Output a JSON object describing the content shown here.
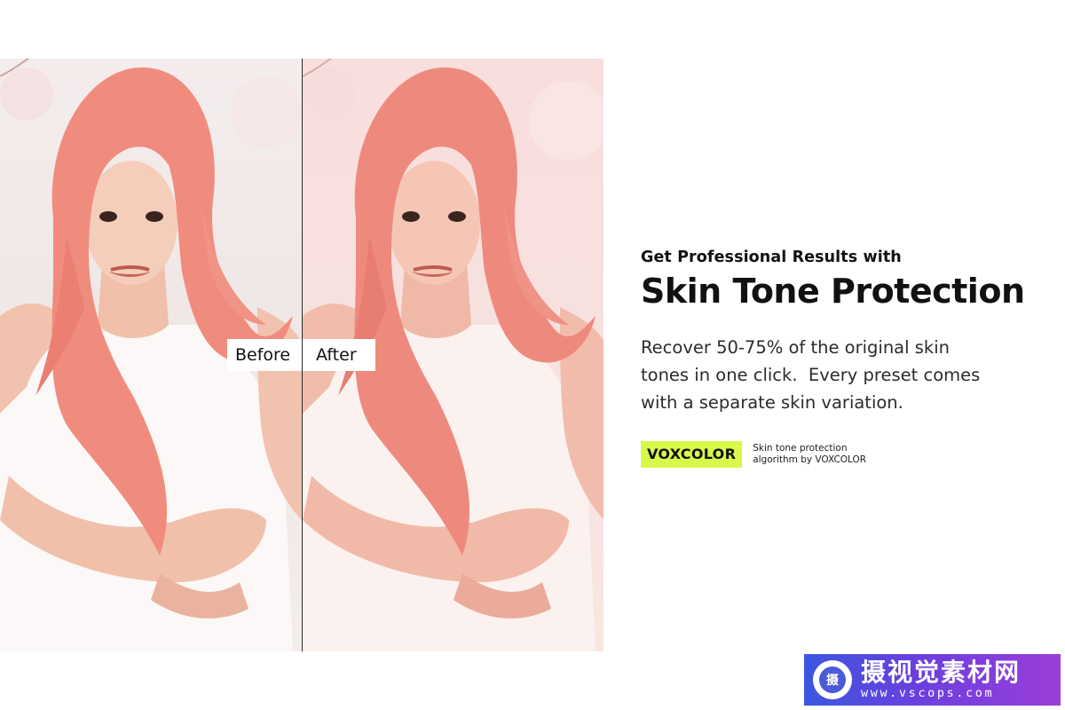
{
  "comparison": {
    "before_label": "Before",
    "after_label": "After",
    "colors": {
      "before_background": "#f1eae8",
      "after_background": "#f8dfdd",
      "hair": "#f08c7e",
      "skin_before": "#f3c8b4",
      "skin_after": "#f4c0b2",
      "dress": "#fbf8f7",
      "divider": "#2a2a2a"
    }
  },
  "copy": {
    "eyebrow": "Get Professional Results with",
    "headline": "Skin Tone Protection",
    "body_line_1": "Recover 50-75% of the original skin",
    "body_line_2": "tones in one click.  Every preset comes",
    "body_line_3": "with a separate skin variation."
  },
  "brand": {
    "badge": "VOXCOLOR",
    "caption_line_1": "Skin tone protection",
    "caption_line_2": "algorithm by VOXCOLOR",
    "badge_color": "#d9f94a"
  },
  "watermark": {
    "logo_icon": "camera-lens-icon",
    "logo_char": "摄",
    "title": "摄视觉素材网",
    "url": "www.vscops.com",
    "colors": [
      "#3b56e0",
      "#9b3ed8"
    ]
  }
}
